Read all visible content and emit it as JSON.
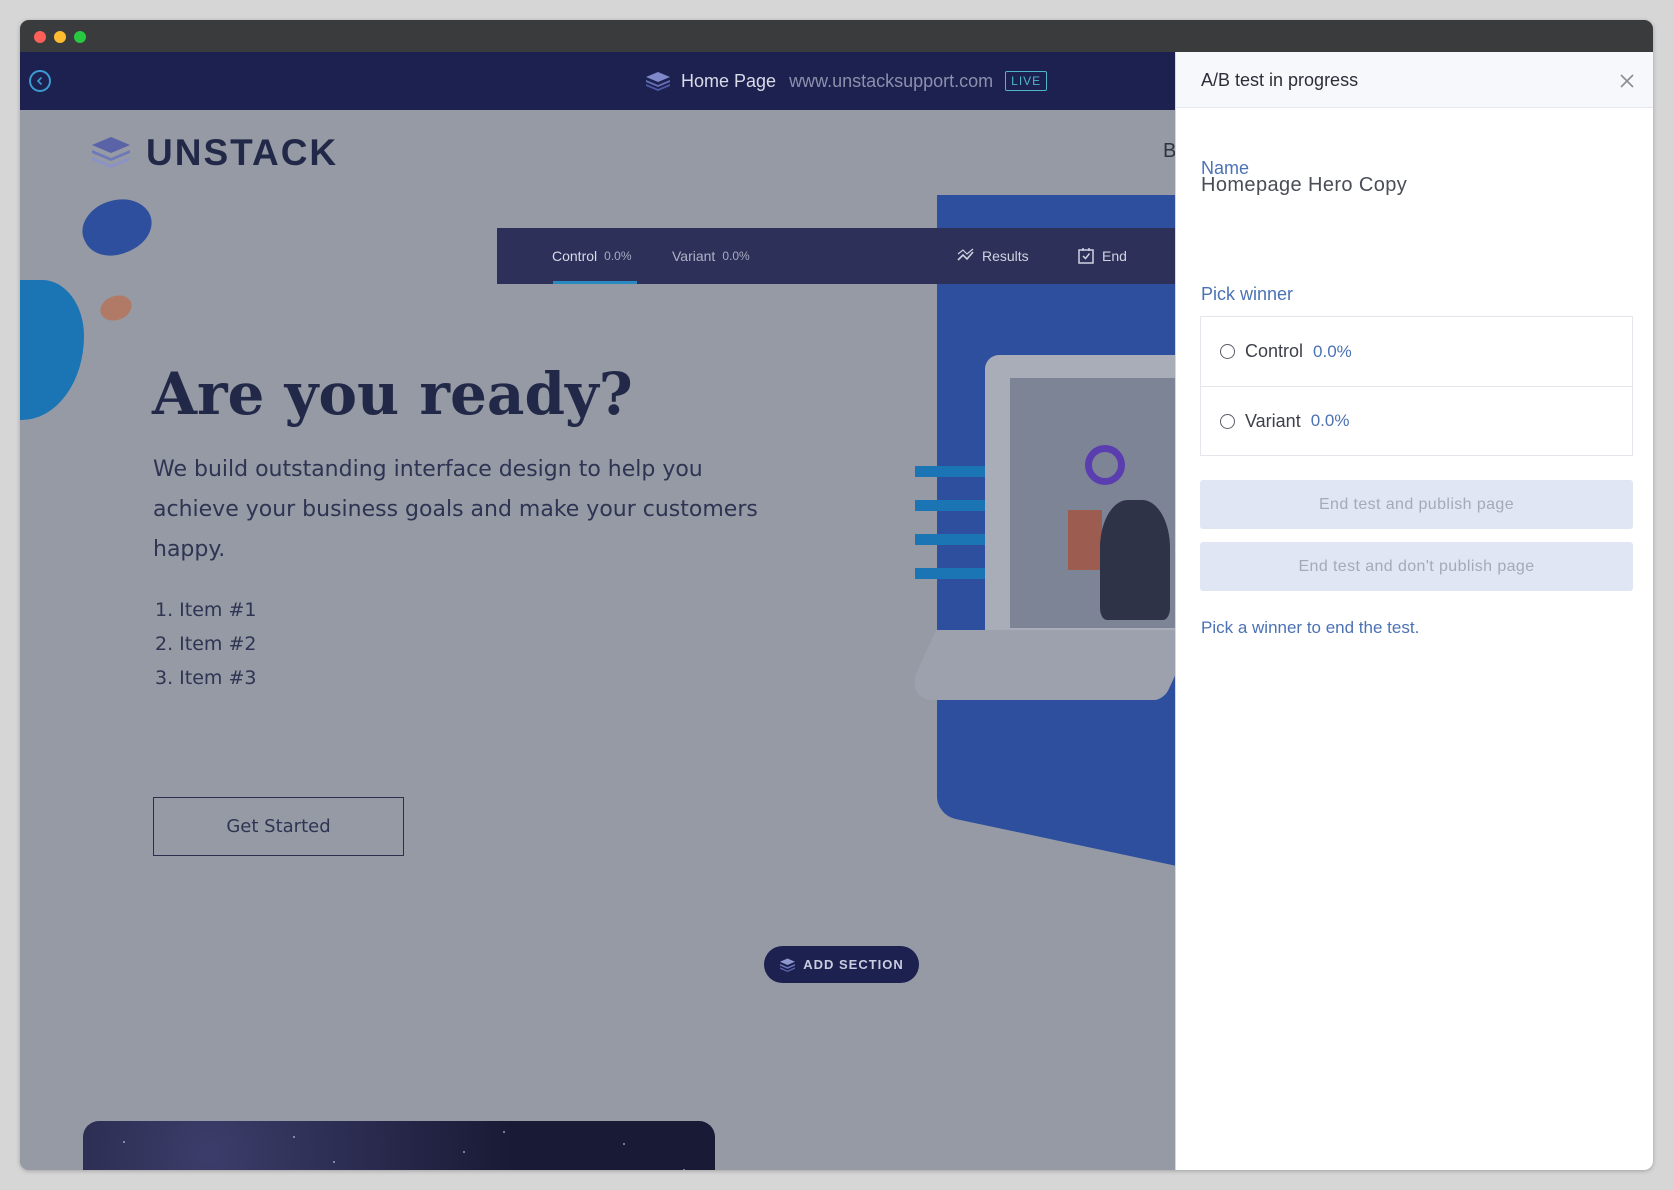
{
  "topbar": {
    "page_name": "Home Page",
    "page_url": "www.unstacksupport.com",
    "status_badge": "LIVE"
  },
  "site": {
    "brand_name": "UNSTACK",
    "nav_partial": "B",
    "headline": "Are you ready?",
    "subtext": "We build outstanding interface design to help you achieve your business goals and make your customers happy.",
    "list_items": [
      "1. Item #1",
      "2. Item #2",
      "3. Item #3"
    ],
    "cta_label": "Get Started",
    "add_section_label": "ADD SECTION"
  },
  "ab_bar": {
    "tabs": [
      {
        "label": "Control",
        "pct": "0.0%",
        "active": true
      },
      {
        "label": "Variant",
        "pct": "0.0%",
        "active": false
      }
    ],
    "results_label": "Results",
    "end_label": "End"
  },
  "panel": {
    "title": "A/B test in progress",
    "name_label": "Name",
    "name_value": "Homepage Hero Copy",
    "pick_label": "Pick winner",
    "options": [
      {
        "label": "Control",
        "pct": "0.0%"
      },
      {
        "label": "Variant",
        "pct": "0.0%"
      }
    ],
    "publish_button": "End test and publish page",
    "no_publish_button": "End test and don't publish page",
    "hint": "Pick a winner to end the test."
  },
  "colors": {
    "topbar": "#1d2150",
    "accent_blue": "#4b72b4",
    "live_badge": "#4fb6c9",
    "hero_panel": "#2d4f9e"
  },
  "icons": [
    "back-arrow-icon",
    "unstack-logo-icon",
    "results-icon",
    "end-icon",
    "close-icon",
    "radio-icon"
  ]
}
